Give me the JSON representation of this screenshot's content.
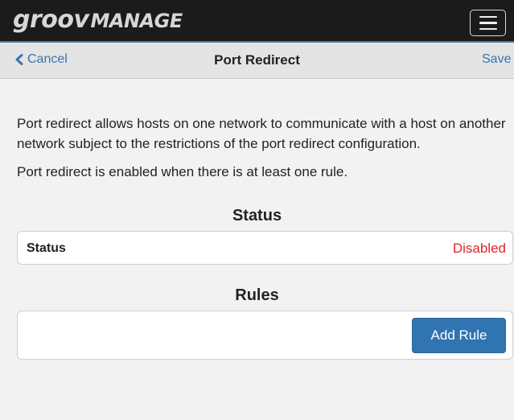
{
  "app": {
    "logo_part1": "groov",
    "logo_part2": "MANAGE",
    "menu_icon": "hamburger-menu-icon"
  },
  "nav": {
    "cancel_label": "Cancel",
    "cancel_icon": "chevron-left-icon",
    "title": "Port Redirect",
    "save_label": "Save"
  },
  "intro": {
    "paragraph1": "Port redirect allows hosts on one network to communicate with a host on another network subject to the restrictions of the port redirect configuration.",
    "paragraph2": "Port redirect is enabled when there is at least one rule."
  },
  "status_section": {
    "heading": "Status",
    "label": "Status",
    "value": "Disabled",
    "value_color": "#e0242a"
  },
  "rules_section": {
    "heading": "Rules",
    "add_button_label": "Add Rule",
    "button_color": "#3174b2"
  },
  "colors": {
    "accent": "#3576b3",
    "topbar": "#1b1b1b",
    "navbar": "#e4e4e4",
    "background": "#f2f2f2"
  }
}
